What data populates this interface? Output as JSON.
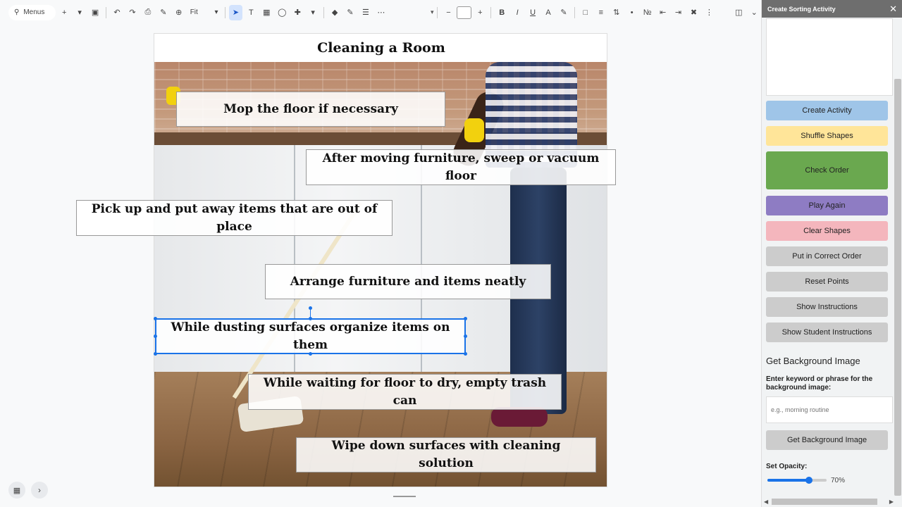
{
  "toolbar": {
    "menus_label": "Menus",
    "zoom_label": "Fit"
  },
  "slide": {
    "title": "Cleaning a Room",
    "cards": [
      {
        "name": "card-mop-floor",
        "text": "Mop the floor if necessary",
        "selected": false
      },
      {
        "name": "card-sweep-vacuum",
        "text": "After moving furniture, sweep or vacuum floor",
        "selected": false
      },
      {
        "name": "card-pick-up-items",
        "text": "Pick up and put away items that are out of place",
        "selected": false
      },
      {
        "name": "card-arrange-furniture",
        "text": "Arrange furniture and items neatly",
        "selected": false
      },
      {
        "name": "card-dusting-surfaces",
        "text": "While dusting surfaces organize items on them",
        "selected": true
      },
      {
        "name": "card-empty-trash",
        "text": "While waiting for floor to dry, empty trash can",
        "selected": false
      },
      {
        "name": "card-wipe-surfaces",
        "text": "Wipe down surfaces with cleaning solution",
        "selected": false
      }
    ]
  },
  "sidebar": {
    "title": "Create Sorting Activity",
    "buttons": [
      {
        "label": "Create Activity",
        "color": "#9fc5e8"
      },
      {
        "label": "Shuffle Shapes",
        "color": "#ffe599"
      },
      {
        "label": "Check Order",
        "color": "#6aa84f"
      },
      {
        "label": "Play Again",
        "color": "#8e7cc3"
      },
      {
        "label": "Clear Shapes",
        "color": "#f4b6bd"
      },
      {
        "label": "Put in Correct Order",
        "color": "#cccccc"
      },
      {
        "label": "Reset Points",
        "color": "#cccccc"
      },
      {
        "label": "Show Instructions",
        "color": "#cccccc"
      },
      {
        "label": "Show Student Instructions",
        "color": "#cccccc"
      }
    ],
    "bg_heading": "Get Background Image",
    "bg_prompt": "Enter keyword or phrase for the background image:",
    "bg_placeholder": "e.g., morning routine",
    "bg_button": "Get Background Image",
    "opacity_label": "Set Opacity:",
    "opacity_value": "70%",
    "opacity_fraction": 0.7
  }
}
